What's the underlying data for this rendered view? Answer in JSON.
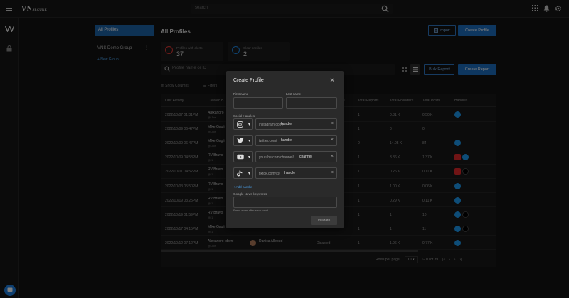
{
  "topbar": {
    "logo_main": "VN",
    "logo_sub": "SECURE",
    "search_placeholder": "search"
  },
  "sidebar_icons": [
    "vn-logo-icon",
    "lock-icon"
  ],
  "left_panel": {
    "all_profiles": "All Profiles",
    "group_name": "VNS Demo Group",
    "group_menu": "⋮",
    "new_group": "+ New Group"
  },
  "header": {
    "title": "All Profiles",
    "import_label": "Import",
    "create_profile_label": "Create Profile"
  },
  "cards": [
    {
      "label": "Profiles with alerts",
      "value": "37",
      "color": "#e53935"
    },
    {
      "label": "Clear profiles",
      "value": "2",
      "color": "#1e88e5"
    }
  ],
  "search": {
    "placeholder": "Profile name or ID",
    "bulk_report": "Bulk Report",
    "create_report": "Create Report"
  },
  "toolbar": {
    "show_columns": "Show Columns",
    "filters": "Filters"
  },
  "table": {
    "headers": [
      "Last Activity",
      "Created B",
      "e",
      "Total Reports",
      "Total Followers",
      "Total Posts",
      "Handles"
    ],
    "rows": [
      {
        "last": "2022/10/07 01:31PM",
        "by": "Alexandro",
        "by_sub": "@ Joe",
        "reports": "1",
        "followers": "0.31 K",
        "posts": "0.50 K",
        "handles": [
          "twitter"
        ]
      },
      {
        "last": "2022/10/09 06:47PM",
        "by": "Mike Gagli",
        "by_sub": "@ Joe",
        "reports": "1",
        "followers": "0",
        "posts": "0",
        "handles": []
      },
      {
        "last": "2022/10/09 06:47PM",
        "by": "Mike Gagli",
        "by_sub": "@ Joe",
        "reports": "0",
        "followers": "14.05 K",
        "posts": "84",
        "handles": [
          "twitter"
        ]
      },
      {
        "last": "2022/10/09 04:58PM",
        "by": "RV Bravo",
        "by_sub": "@ 1",
        "reports": "1",
        "followers": "3.36 K",
        "posts": "1.37 K",
        "handles": [
          "youtube",
          "twitter"
        ]
      },
      {
        "last": "2022/10/01 04:52PM",
        "by": "RV Bravo",
        "by_sub": "@ 1",
        "reports": "1",
        "followers": "0.26 K",
        "posts": "0.11 K",
        "handles": [
          "youtube",
          "tiktok"
        ]
      },
      {
        "last": "2022/10/03 05:50PM",
        "by": "RV Bravo",
        "by_sub": "@ 1",
        "reports": "1",
        "followers": "1.00 K",
        "posts": "0.06 K",
        "handles": [
          "twitter"
        ]
      },
      {
        "last": "2022/10/19 03:25PM",
        "by": "RV Bravo",
        "by_sub": "@ 1",
        "reports": "1",
        "followers": "0.29 K",
        "posts": "0.11 K",
        "handles": [
          "twitter"
        ]
      },
      {
        "last": "2022/10/19 01:59PM",
        "by": "RV Bravo",
        "by_sub": "@ 1",
        "reports": "1",
        "followers": "1",
        "posts": "10",
        "handles": [
          "twitter",
          "tiktok"
        ]
      },
      {
        "last": "2022/10/17 04:15PM",
        "by": "Mike Gagli",
        "by_sub": "@ 1",
        "reports": "1",
        "followers": "1",
        "posts": "11",
        "handles": [
          "twitter",
          "tiktok"
        ]
      },
      {
        "last": "2022/10/12 07:12PM",
        "by": "Alexandro Idorni",
        "by_sub": "@ Joe",
        "name": "Danica Alleoud",
        "status": "Disabled",
        "reports": "1",
        "followers": "1.96 K",
        "posts": "0.77 K",
        "handles": [
          "twitter"
        ]
      }
    ]
  },
  "pagination": {
    "rows_per_page_label": "Rows per page:",
    "rows_per_page": "10",
    "range": "1–10 of 39"
  },
  "modal": {
    "title": "Create Profile",
    "first_name_label": "First name",
    "last_name_label": "Last name",
    "social_handles_label": "Social Handles",
    "handles": [
      {
        "icon": "instagram-icon",
        "prefix": "instagram.com/",
        "value": "handle"
      },
      {
        "icon": "twitter-icon",
        "prefix": "twitter.com/",
        "value": "handle"
      },
      {
        "icon": "youtube-icon",
        "prefix": "youtube.com/channel/",
        "value": "channel"
      },
      {
        "icon": "tiktok-icon",
        "prefix": "tiktok.com/@",
        "value": "handle"
      }
    ],
    "add_handle": "+ Add handle",
    "keywords_label": "Google News keywords",
    "keywords_hint": "Press enter after each word",
    "validate": "Validate"
  }
}
